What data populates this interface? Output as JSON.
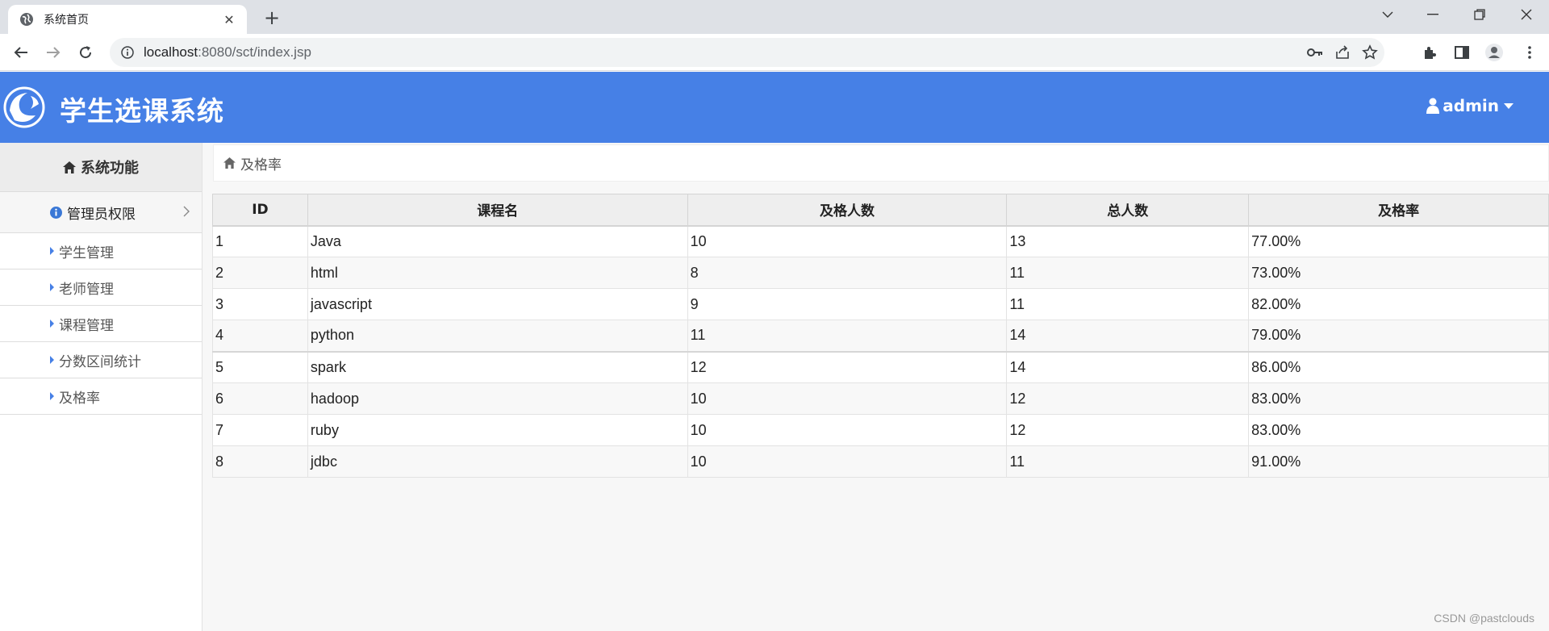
{
  "browser": {
    "tab_title": "系统首页",
    "url_host": "localhost",
    "url_rest": ":8080/sct/index.jsp"
  },
  "header": {
    "app_title": "学生选课系统",
    "user_name": "admin"
  },
  "sidebar": {
    "heading": "系统功能",
    "group_label": "管理员权限",
    "items": [
      {
        "label": "学生管理"
      },
      {
        "label": "老师管理"
      },
      {
        "label": "课程管理"
      },
      {
        "label": "分数区间统计"
      },
      {
        "label": "及格率"
      }
    ]
  },
  "breadcrumb": {
    "current": "及格率"
  },
  "table": {
    "columns": [
      "ID",
      "课程名",
      "及格人数",
      "总人数",
      "及格率"
    ],
    "rows": [
      [
        "1",
        "Java",
        "10",
        "13",
        "77.00%"
      ],
      [
        "2",
        "html",
        "8",
        "11",
        "73.00%"
      ],
      [
        "3",
        "javascript",
        "9",
        "11",
        "82.00%"
      ],
      [
        "4",
        "python",
        "11",
        "14",
        "79.00%"
      ],
      [
        "5",
        "spark",
        "12",
        "14",
        "86.00%"
      ],
      [
        "6",
        "hadoop",
        "10",
        "12",
        "83.00%"
      ],
      [
        "7",
        "ruby",
        "10",
        "12",
        "83.00%"
      ],
      [
        "8",
        "jdbc",
        "10",
        "11",
        "91.00%"
      ]
    ]
  },
  "watermark": "CSDN @pastclouds",
  "colors": {
    "header_bg": "#4680e6",
    "accent": "#4680e6"
  }
}
